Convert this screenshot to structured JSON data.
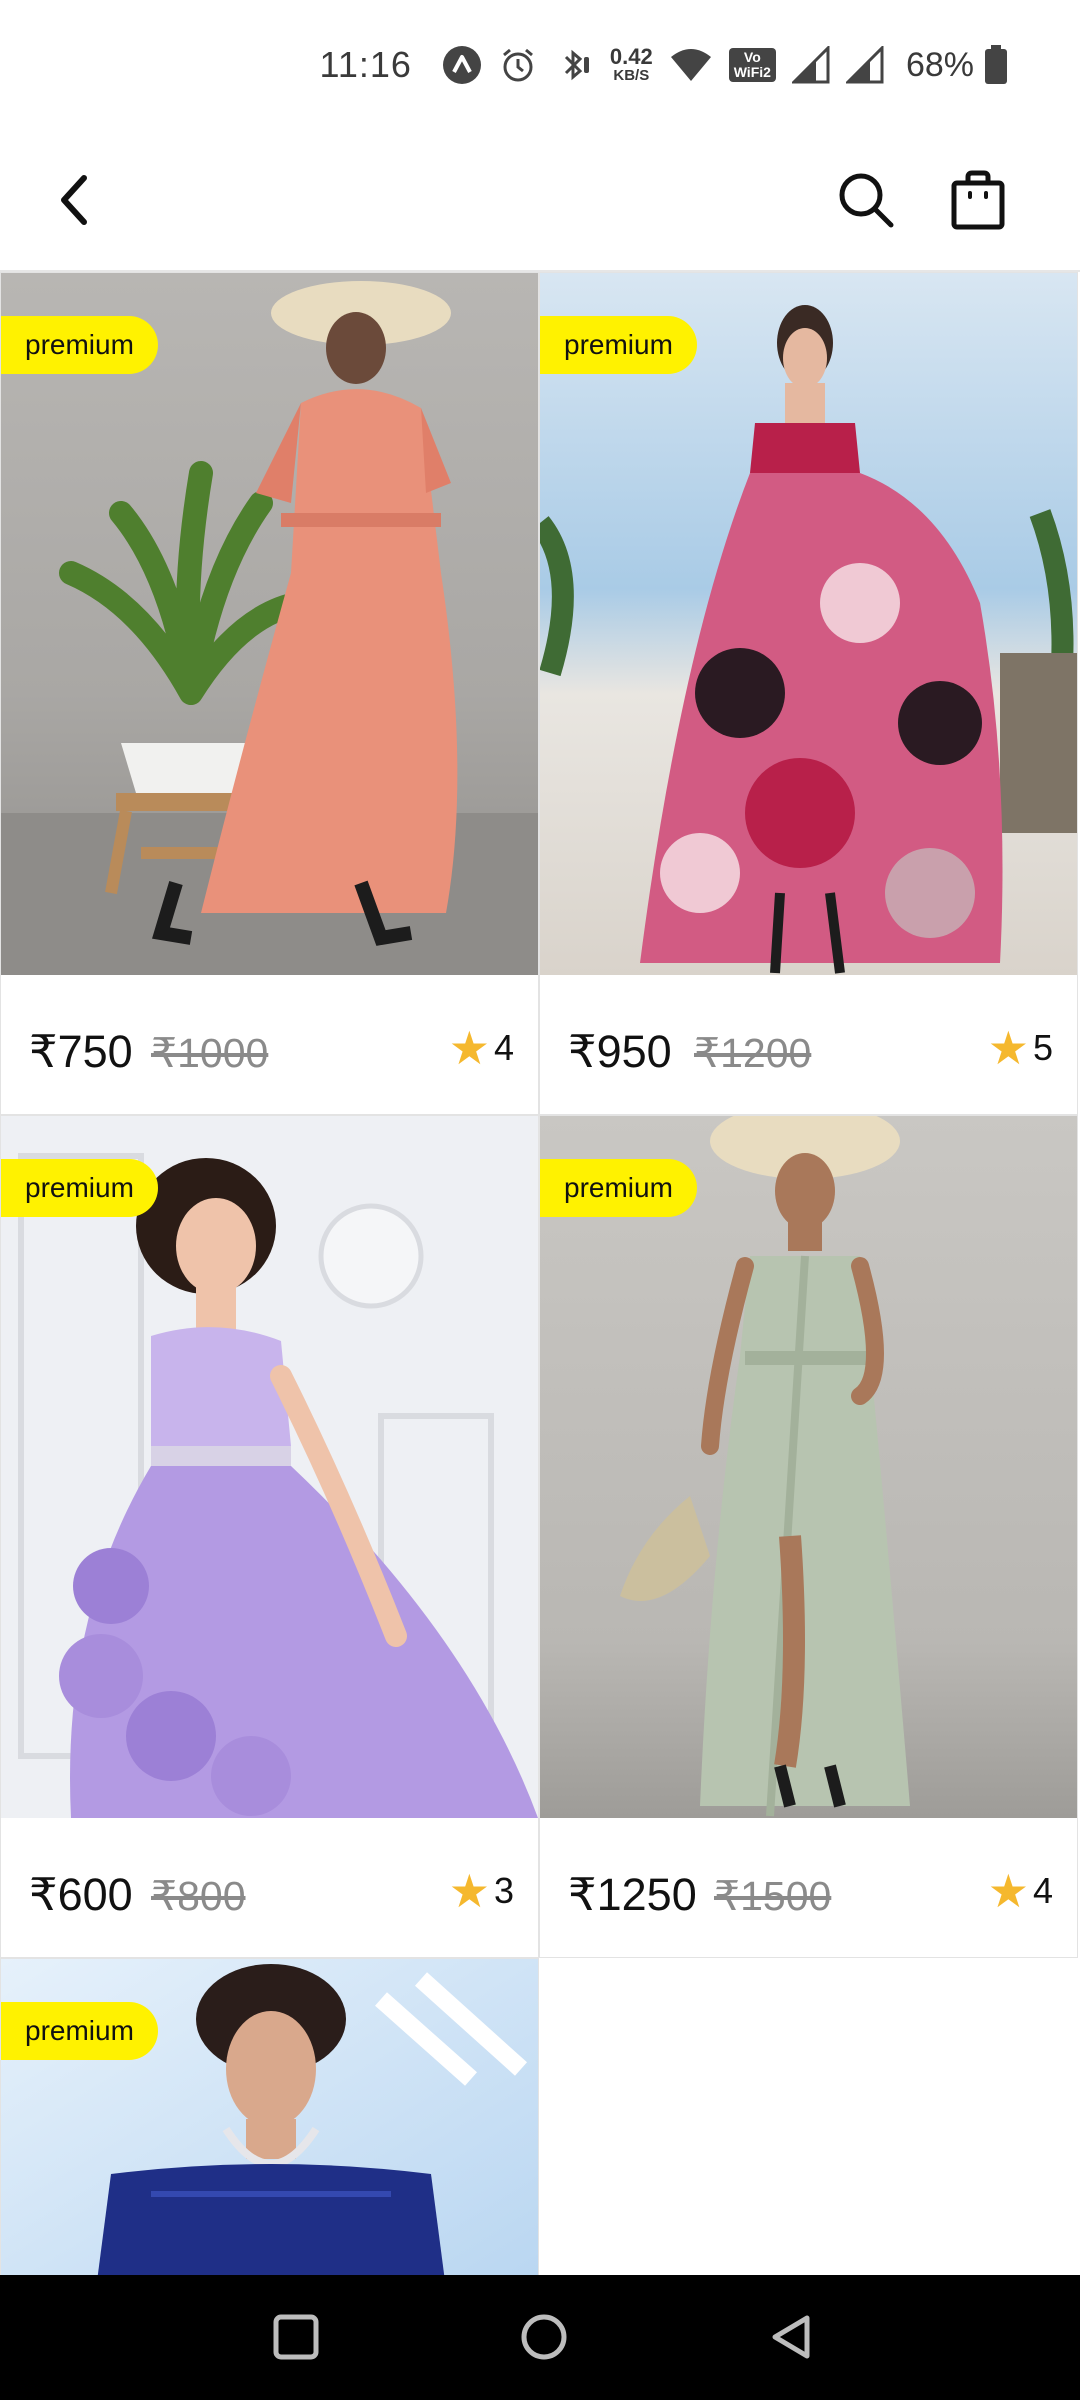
{
  "status_bar": {
    "time": "11:16",
    "net_speed_value": "0.42",
    "net_speed_unit": "KB/S",
    "volte_top": "Vo",
    "volte_bottom": "WiFi2",
    "battery": "68%"
  },
  "app_bar": {
    "icons": [
      "back-arrow-icon",
      "search-icon",
      "shopping-bag-icon"
    ]
  },
  "products": [
    {
      "badge": "premium",
      "price": "₹750",
      "old_price": "₹1000",
      "rating": "4",
      "image": "woman-in-coral-maxi-dress-with-sun-hat"
    },
    {
      "badge": "premium",
      "price": "₹950",
      "old_price": "₹1200",
      "rating": "5",
      "image": "woman-in-pink-rose-print-gown"
    },
    {
      "badge": "premium",
      "price": "₹600",
      "old_price": "₹800",
      "rating": "3",
      "image": "woman-in-lavender-ruffled-gown"
    },
    {
      "badge": "premium",
      "price": "₹1250",
      "old_price": "₹1500",
      "rating": "4",
      "image": "woman-in-sage-green-wrap-dress"
    },
    {
      "badge": "premium",
      "image": "woman-in-navy-off-shoulder-dress"
    }
  ],
  "colors": {
    "badge": "#fff200",
    "star": "#f5b82e",
    "nav_bar": "#000000"
  },
  "nav_bar": {
    "icons": [
      "recent-apps-icon",
      "home-icon",
      "back-triangle-icon"
    ]
  }
}
